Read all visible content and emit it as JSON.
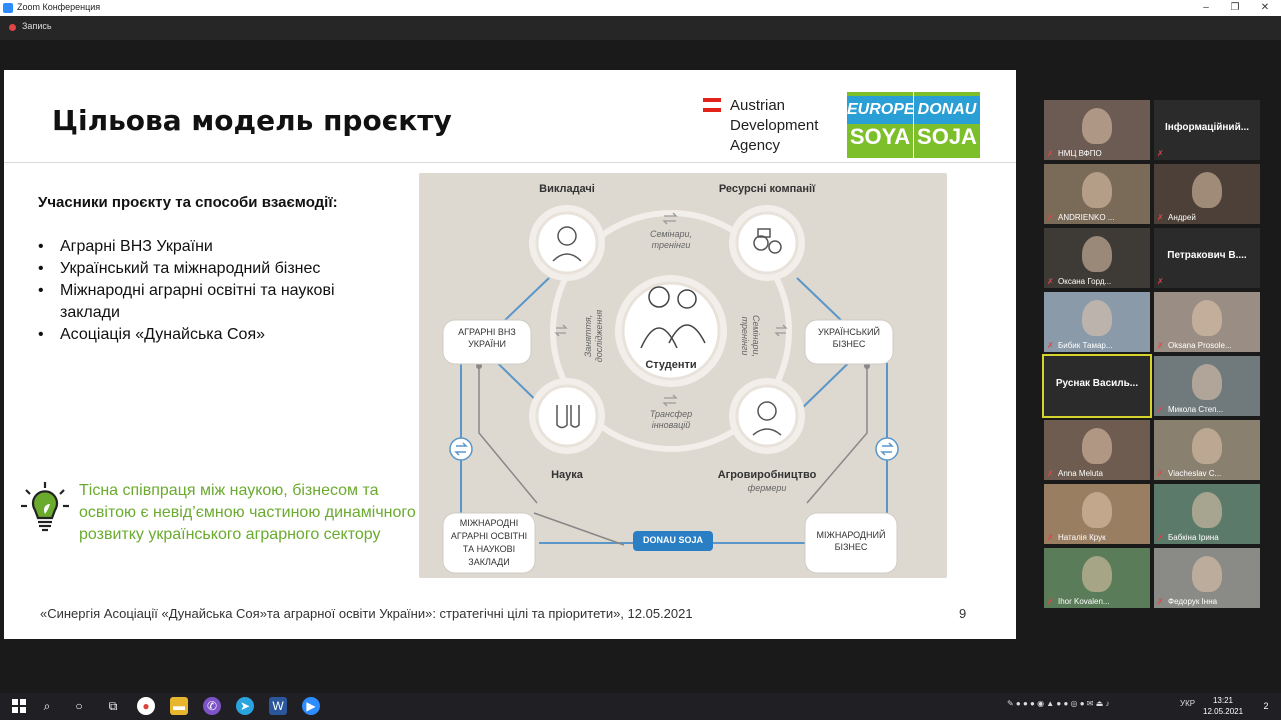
{
  "window": {
    "title": "Zoom Конференция",
    "controls": {
      "minimize": "–",
      "restore": "❐",
      "close": "✕"
    }
  },
  "recording": {
    "label": "Запись"
  },
  "slide": {
    "title": "Цільова модель проєкту",
    "partner": {
      "line1": "Austrian",
      "line2": "Development",
      "line3": "Agency"
    },
    "logos": {
      "europe_soya": {
        "top": "EUROPE",
        "bottom": "SOYA"
      },
      "donau_soja": {
        "top": "DONAU",
        "bottom": "SOJA"
      }
    },
    "subheading": "Учасники проєкту та способи взаємодії:",
    "bullets": [
      "Аграрні ВНЗ України",
      "Український та міжнародний бізнес",
      "Міжнародні аграрні освітні та наукові заклади",
      "Асоціація «Дунайська Соя»"
    ],
    "highlight_text": "Тісна співпраця між наукою, бізнесом та освітою є невід’ємною частиною динамічного розвитку українського аграрного сектору",
    "diagram": {
      "nodes": {
        "teachers": "Викладачі",
        "resource_companies": "Ресурсні компанії",
        "students": "Студенти",
        "science": "Наука",
        "agro": "Агровиробництво",
        "agro_sub": "фермери"
      },
      "links": {
        "seminars": [
          "Семінари,",
          "тренінги"
        ],
        "classes": [
          "Заняття,",
          "дослідження"
        ],
        "seminars_right": [
          "Семінари,",
          "тренінги"
        ],
        "transfer": [
          "Трансфер",
          "інновацій"
        ]
      },
      "corners": {
        "ua_universities": [
          "АГРАРНІ ВНЗ",
          "УКРАЇНИ"
        ],
        "ua_business": [
          "УКРАЇНСЬКИЙ",
          "БІЗНЕС"
        ],
        "intl_institutions": [
          "МІЖНАРОДНІ",
          "АГРАРНІ ОСВІТНІ",
          "ТА НАУКОВІ",
          "ЗАКЛАДИ"
        ],
        "intl_business": [
          "МІЖНАРОДНИЙ",
          "БІЗНЕС"
        ]
      },
      "center_badge": "DONAU SOJA"
    },
    "footer": "«Синергія Асоціації «Дунайська Соя»та аграрної освіти України»: стратегічні цілі та пріоритети», 12.05.2021",
    "page_number": "9"
  },
  "participants": [
    {
      "name": "НМЦ ВФПО",
      "video": true,
      "bg": "#6b5b52"
    },
    {
      "name": "Інформаційний...",
      "video": false,
      "bg": "#2b2b2b"
    },
    {
      "name": "ANDRIENKO ...",
      "video": true,
      "bg": "#7a6a58"
    },
    {
      "name": "Андрей",
      "video": true,
      "bg": "#4c4038"
    },
    {
      "name": "Оксана Горд...",
      "video": true,
      "bg": "#3e3a36"
    },
    {
      "name": "Петракович В....",
      "video": false,
      "bg": "#2b2b2b"
    },
    {
      "name": "Бибик Тамар...",
      "video": true,
      "bg": "#8a9aa8"
    },
    {
      "name": "Oksana Prosole...",
      "video": true,
      "bg": "#9a8e84"
    },
    {
      "name": "Руснак Василь...",
      "video": false,
      "bg": "#2b2b2b",
      "active": true
    },
    {
      "name": "Микола Степ...",
      "video": true,
      "bg": "#707a7c"
    },
    {
      "name": "Anna Meluta",
      "video": true,
      "bg": "#6e5c50"
    },
    {
      "name": "Viacheslav C...",
      "video": true,
      "bg": "#8a8070"
    },
    {
      "name": "Наталія Крук",
      "video": true,
      "bg": "#9a7e62"
    },
    {
      "name": "Бабкіна Ірина",
      "video": true,
      "bg": "#5c7a6a"
    },
    {
      "name": "Ihor Kovalen...",
      "video": true,
      "bg": "#5a7c58"
    },
    {
      "name": "Федорук Інна",
      "video": true,
      "bg": "#8a8a86"
    }
  ],
  "taskbar": {
    "language": "УКР",
    "time": "13:21",
    "date": "12.05.2021",
    "notifications": "2"
  }
}
